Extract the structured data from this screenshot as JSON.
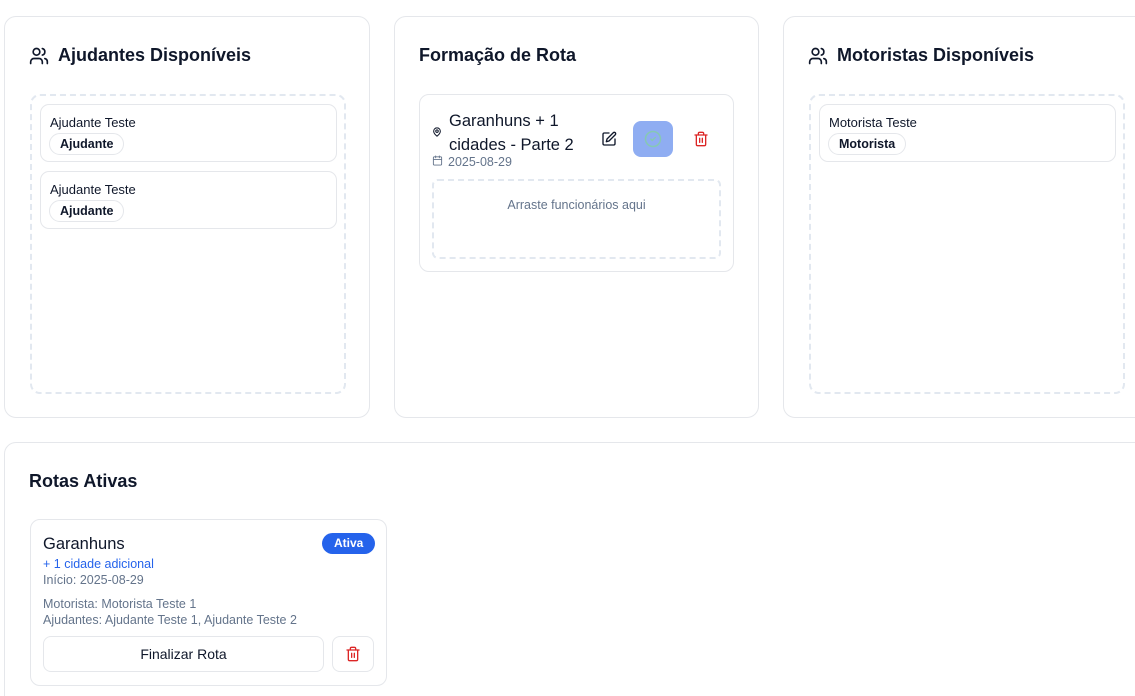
{
  "helpers_panel": {
    "title": "Ajudantes Disponíveis",
    "icon": "users-icon",
    "items": [
      {
        "name": "Ajudante Teste",
        "role": "Ajudante"
      },
      {
        "name": "Ajudante Teste",
        "role": "Ajudante"
      }
    ]
  },
  "route_formation": {
    "title": "Formação de Rota",
    "route": {
      "name": "Garanhuns + 1 cidades - Parte 2",
      "date": "2025-08-29",
      "drop_hint": "Arraste funcionários aqui"
    }
  },
  "drivers_panel": {
    "title": "Motoristas Disponíveis",
    "icon": "users-icon",
    "items": [
      {
        "name": "Motorista Teste",
        "role": "Motorista"
      }
    ]
  },
  "active_routes": {
    "title": "Rotas Ativas",
    "routes": [
      {
        "city": "Garanhuns",
        "status": "Ativa",
        "extra_cities": "+ 1 cidade adicional",
        "start": "Início: 2025-08-29",
        "driver": "Motorista: Motorista Teste 1",
        "helpers": "Ajudantes: Ajudante Teste 1, Ajudante Teste 2",
        "finish_label": "Finalizar Rota"
      }
    ]
  },
  "colors": {
    "primary": "#2563eb",
    "confirm_bg": "#8fadf2",
    "danger": "#dc2626",
    "border": "#e5e7eb",
    "muted_text": "#64748b"
  }
}
